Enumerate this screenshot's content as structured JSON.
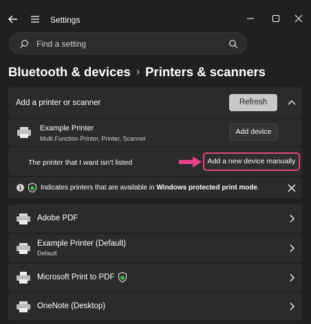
{
  "window": {
    "title": "Settings",
    "controls": [
      "minimize",
      "maximize",
      "close"
    ]
  },
  "search": {
    "placeholder": "Find a setting"
  },
  "breadcrumb": {
    "parent": "Bluetooth & devices",
    "separator": "›",
    "current": "Printers & scanners"
  },
  "add_section": {
    "label": "Add a printer or scanner",
    "refresh_label": "Refresh",
    "found_printer": {
      "name": "Example Printer",
      "type": "Multi Function Printer, Printer, Scanner",
      "add_label": "Add device"
    },
    "not_listed": {
      "text": "The printer that I want isn’t listed",
      "manual_label": "Add a new device manually"
    }
  },
  "info_banner": {
    "text_prefix": "Indicates printers that are available in ",
    "text_bold": "Windows protected print mode",
    "text_suffix": "."
  },
  "printers": [
    {
      "name": "Adobe PDF",
      "sub": ""
    },
    {
      "name": "Example Printer (Default)",
      "sub": "Default"
    },
    {
      "name": "Microsoft Print to PDF",
      "sub": "",
      "protected": true
    },
    {
      "name": "OneNote (Desktop)",
      "sub": ""
    }
  ],
  "colors": {
    "background": "#202020",
    "card": "#2b2b2b",
    "highlight_border": "#e0457d",
    "arrow": "#e8438a",
    "shield_green": "#3fb950"
  }
}
